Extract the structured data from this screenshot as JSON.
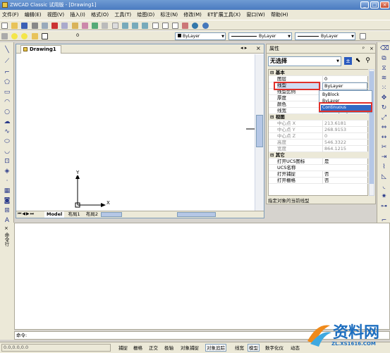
{
  "window": {
    "title": "ZWCAD Classic 试用版 - [Drawing1]"
  },
  "menu": [
    "文件(F)",
    "编辑(E)",
    "视图(V)",
    "插入(I)",
    "格式(O)",
    "工具(T)",
    "绘图(D)",
    "标注(N)",
    "修改(M)",
    "ET扩展工具(X)",
    "窗口(W)",
    "帮助(H)"
  ],
  "toolbar": {
    "layer_value": "0",
    "color_value": "ByLayer",
    "linetype_value": "ByLayer",
    "lineweight_value": "ByLayer"
  },
  "document": {
    "tab_title": "Drawing1",
    "axis_x": "X",
    "axis_y": "Y",
    "layout_tabs": [
      "Model",
      "布局1",
      "布局2"
    ]
  },
  "properties": {
    "title": "属性",
    "selection": "无选择",
    "sections": {
      "basic": "基本",
      "view": "视图",
      "misc": "其它"
    },
    "rows": {
      "layer": {
        "name": "图层",
        "value": "0"
      },
      "linetype": {
        "name": "线型",
        "value": "ByLayer"
      },
      "ltscale": {
        "name": "线型比例",
        "value": "ByBlock"
      },
      "thickness": {
        "name": "厚度",
        "value": "ByLayer"
      },
      "color": {
        "name": "颜色",
        "value": "■ ByLayer"
      },
      "lineweight": {
        "name": "线宽",
        "value": "—— ByLayer"
      },
      "cx": {
        "name": "中心点 X",
        "value": "213.6181"
      },
      "cy": {
        "name": "中心点 Y",
        "value": "268.9153"
      },
      "cz": {
        "name": "中心点 Z",
        "value": "0"
      },
      "height": {
        "name": "高度",
        "value": "546.3322"
      },
      "width": {
        "name": "宽度",
        "value": "864.1215"
      },
      "ucsicon": {
        "name": "打开UCS图标",
        "value": "是"
      },
      "ucsname": {
        "name": "UCS名称",
        "value": ""
      },
      "snap": {
        "name": "打开捕捉",
        "value": "否"
      },
      "grid": {
        "name": "打开栅格",
        "value": "否"
      }
    },
    "dropdown_options": [
      "ByBlock",
      "ByLayer",
      "Continuous"
    ],
    "dropdown_selected": "Continuous",
    "hint": "指定对象的当前线型"
  },
  "command": {
    "side_label": "命令行",
    "prompt": "命令:"
  },
  "status": {
    "coords": "0.0,0.0,0.0",
    "buttons": [
      "捕捉",
      "栅格",
      "正交",
      "极轴",
      "对象捕捉",
      "对象追踪",
      "线宽",
      "模型",
      "数字化仪",
      "动态"
    ]
  },
  "watermark": {
    "text": "资料网",
    "url": "ZL.XS1616.COM"
  }
}
